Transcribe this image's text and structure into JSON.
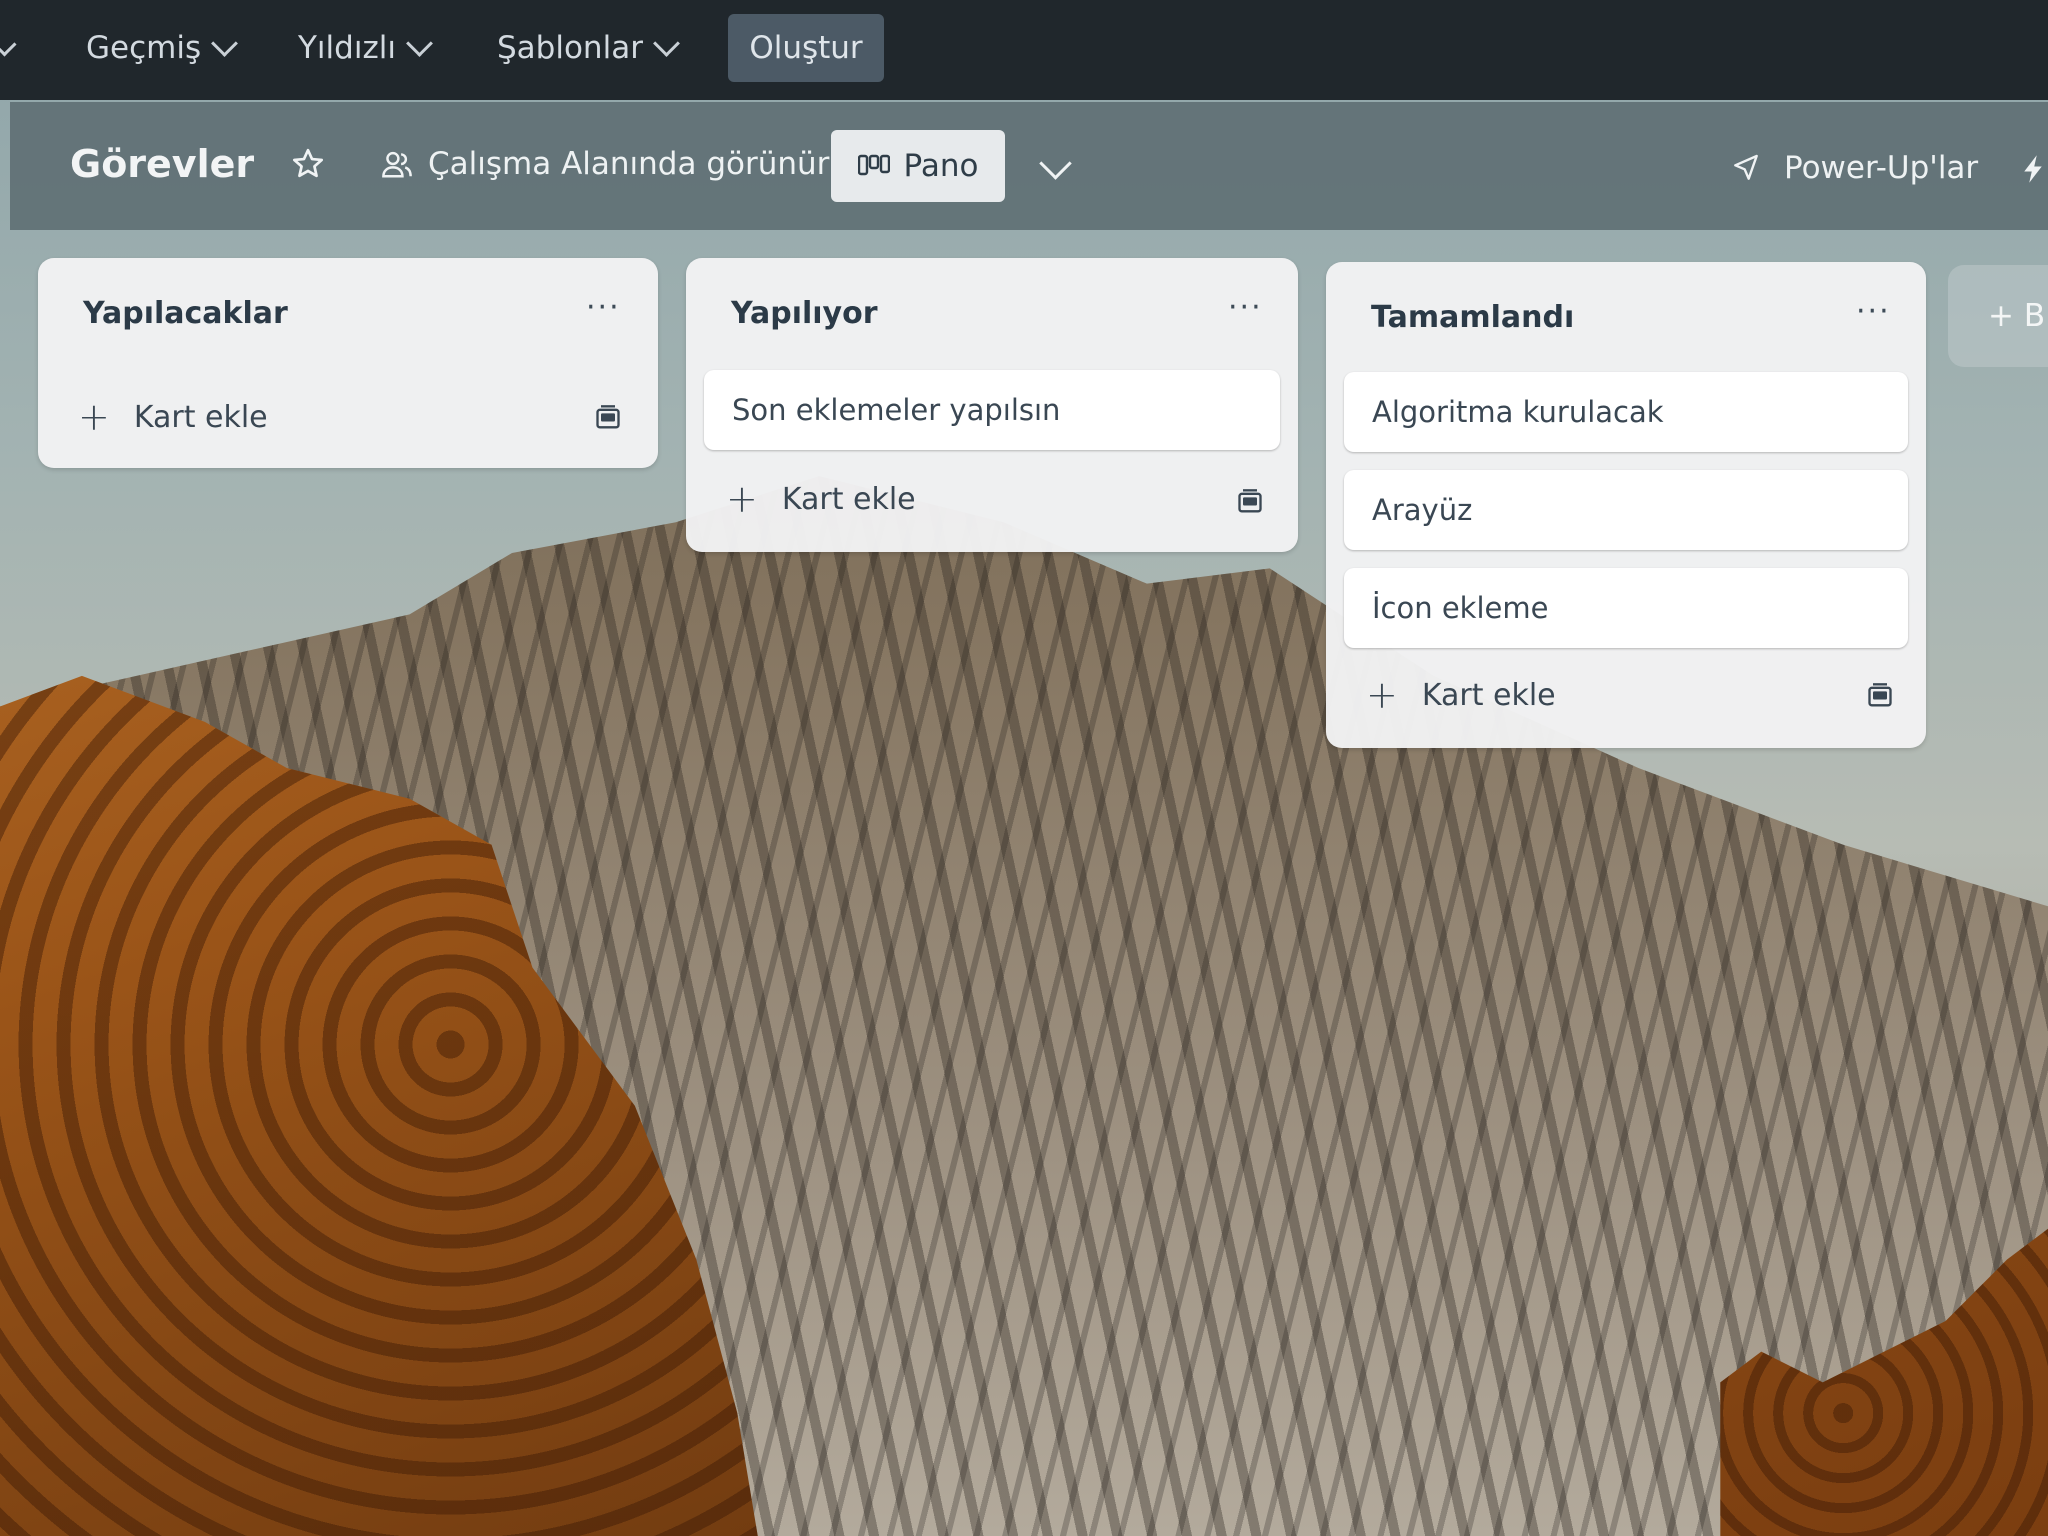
{
  "topbar": {
    "nav": [
      "Geçmiş",
      "Yıldızlı",
      "Şablonlar"
    ],
    "create_label": "Oluştur"
  },
  "board": {
    "title": "Görevler",
    "visibility_label": "Çalışma Alanında görünür",
    "view_label": "Pano",
    "powerups_label": "Power-Up'lar"
  },
  "lists": [
    {
      "title": "Yapılacaklar",
      "menu": "···",
      "cards": [],
      "add_label": "Kart ekle"
    },
    {
      "title": "Yapılıyor",
      "menu": "···",
      "cards": [
        "Son eklemeler yapılsın"
      ],
      "add_label": "Kart ekle"
    },
    {
      "title": "Tamamlandı",
      "menu": "···",
      "cards": [
        "Algoritma kurulacak",
        "Arayüz",
        "İcon ekleme"
      ],
      "add_label": "Kart ekle"
    }
  ],
  "add_list_label": "+ B",
  "icons": [
    "chevron-down-icon",
    "star-icon",
    "people-icon",
    "board-view-icon",
    "rocket-icon",
    "bolt-icon",
    "card-template-icon"
  ],
  "colors": {
    "topbar": "#20272c",
    "create_button": "#4c5a66",
    "board_header": "#607074",
    "list_background": "#f2f2f3",
    "text_dark": "#2b3a47"
  }
}
